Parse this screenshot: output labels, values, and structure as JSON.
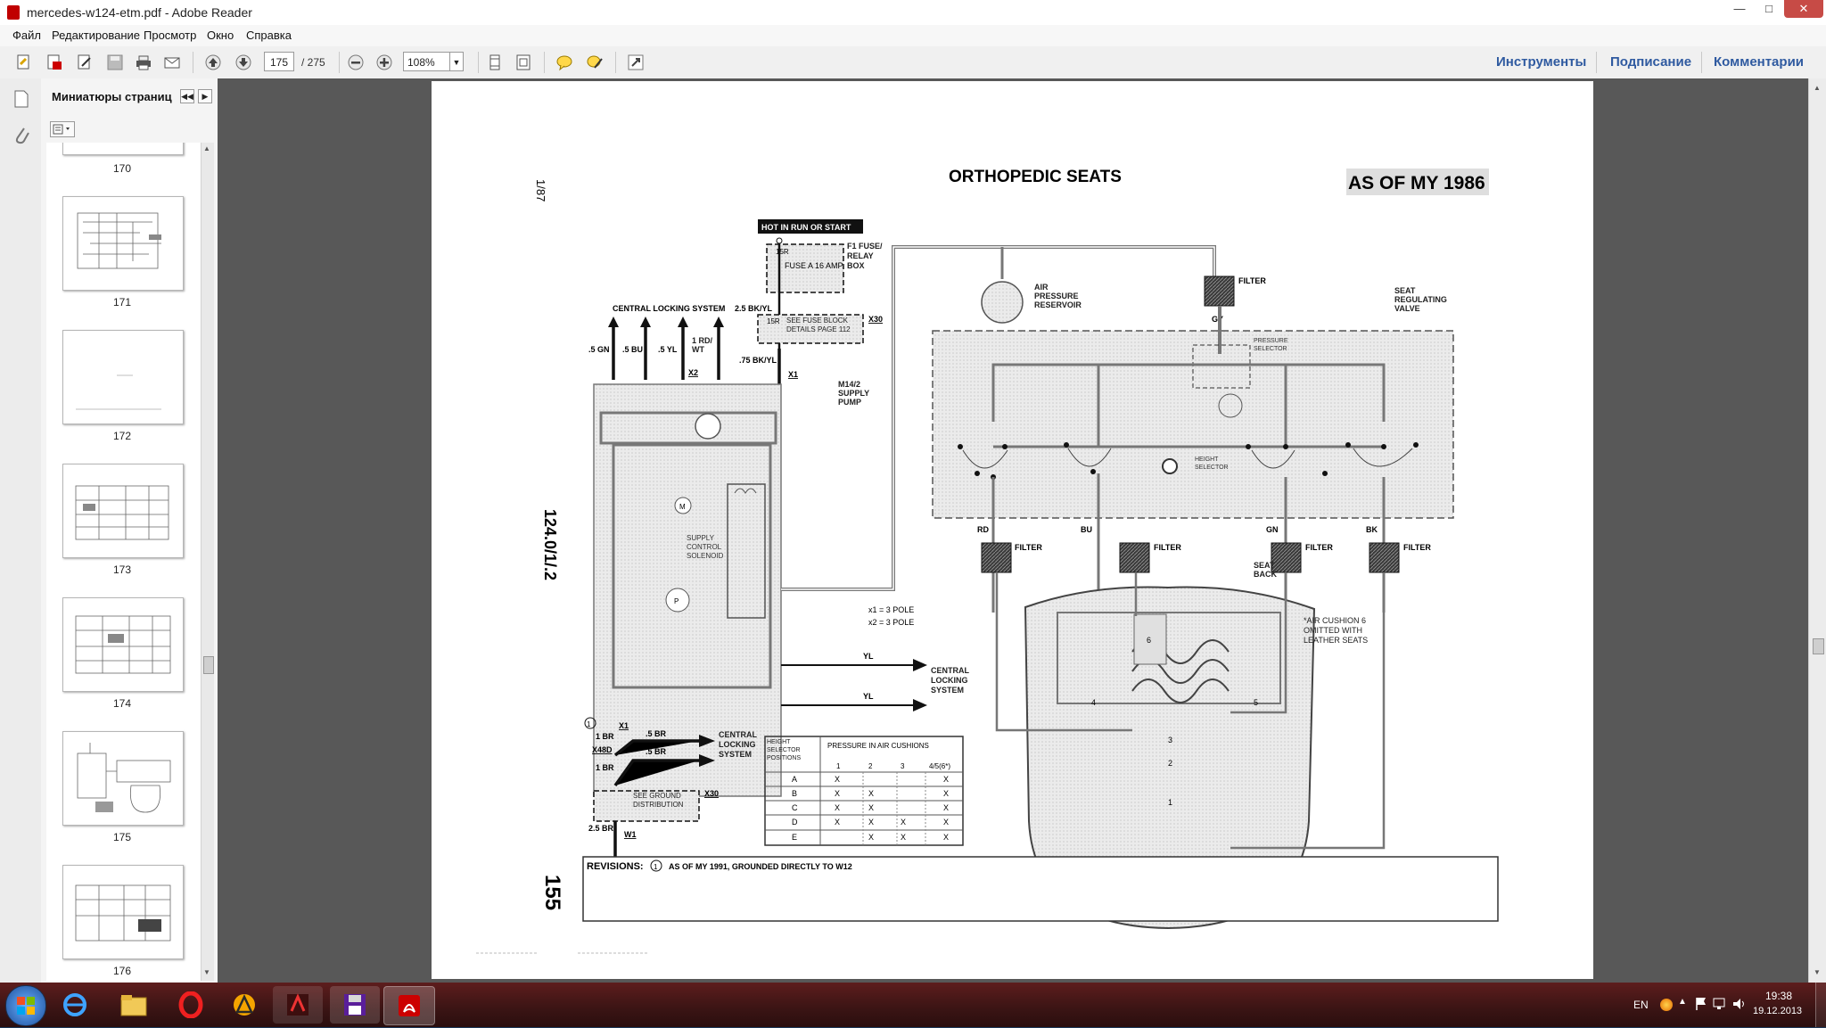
{
  "window": {
    "title": "mercedes-w124-etm.pdf - Adobe Reader"
  },
  "menu": [
    "Файл",
    "Редактирование",
    "Просмотр",
    "Окно",
    "Справка"
  ],
  "toolbar": {
    "page_current": "175",
    "page_total": "/ 275",
    "zoom": "108%",
    "tools_label": "Инструменты",
    "sign_label": "Подписание",
    "comment_label": "Комментарии"
  },
  "sidebar": {
    "panel_title": "Миниатюры страниц",
    "thumbnails": [
      {
        "label": "170"
      },
      {
        "label": "171"
      },
      {
        "label": "172"
      },
      {
        "label": "173"
      },
      {
        "label": "174"
      },
      {
        "label": "175"
      },
      {
        "label": "176"
      }
    ]
  },
  "document": {
    "title": "ORTHOPEDIC SEATS",
    "badge": "AS OF MY 1986",
    "ref_top": "1/87",
    "ref_side": "124.0/1/.2",
    "page_no": "155",
    "revisions_label": "REVISIONS:",
    "revisions_text": "AS OF MY 1991, GROUNDED DIRECTLY TO W12",
    "revision_mark": "1",
    "labels": {
      "hot": "HOT IN RUN OR START",
      "fuse_block": "F1 FUSE/ RELAY BOX",
      "fuse": "FUSE A 16 AMP",
      "fuse_15r": "15R",
      "wire_25bkyl": "2.5 BK/YL",
      "x30": "X30",
      "fuse_detail": "SEE FUSE BLOCK DETAILS PAGE 112",
      "central_locking_top": "CENTRAL LOCKING SYSTEM",
      "w_5gn": ".5 GN",
      "w_5bu": ".5 BU",
      "w_5yl": ".5 YL",
      "w_1rdwt": "1 RD/ WT",
      "w_75bkyl": ".75 BK/YL",
      "x2": "X2",
      "x1": "X1",
      "m142": "M14/2 SUPPLY PUMP",
      "solenoid": "SUPPLY CONTROL SOLENOID",
      "pole1": "x1 = 3 POLE",
      "pole2": "x2 = 3 POLE",
      "yl": "YL",
      "central_locking_right": "CENTRAL LOCKING SYSTEM",
      "central_locking_bottom": "CENTRAL LOCKING SYSTEM",
      "w_1br": "1 BR",
      "x48d": "X48D",
      "w_5br": ".5 BR",
      "w_25br": "2.5 BR",
      "ground_dist": "SEE GROUND DISTRIBUTION",
      "w1": "W1",
      "air_reservoir": "AIR PRESSURE RESERVOIR",
      "filter": "FILTER",
      "gy": "GY",
      "seat_valve": "SEAT REGULATING VALVE",
      "pressure_selector": "PRESSURE SELECTOR",
      "height_selector": "HEIGHT SELECTOR",
      "rd": "RD",
      "bu": "BU",
      "gn": "GN",
      "bk": "BK",
      "seat_back": "SEAT BACK",
      "air_cushion_note": "*AIR CUSHION 6 OMITTED WITH LEATHER SEATS"
    },
    "table": {
      "col1_header": "HEIGHT SELECTOR POSITIONS",
      "col2_header": "PRESSURE IN AIR CUSHIONS",
      "subheaders": [
        "1",
        "2",
        "3",
        "4/5(6*)"
      ],
      "rows": [
        [
          "A",
          "X",
          "",
          "",
          "X"
        ],
        [
          "B",
          "X",
          "X",
          "",
          "X"
        ],
        [
          "C",
          "X",
          "X",
          "",
          "X"
        ],
        [
          "D",
          "X",
          "X",
          "X",
          "X"
        ],
        [
          "E",
          "",
          "X",
          "X",
          "X"
        ]
      ]
    }
  },
  "taskbar": {
    "lang": "EN",
    "time": "19:38",
    "date": "19.12.2013"
  }
}
